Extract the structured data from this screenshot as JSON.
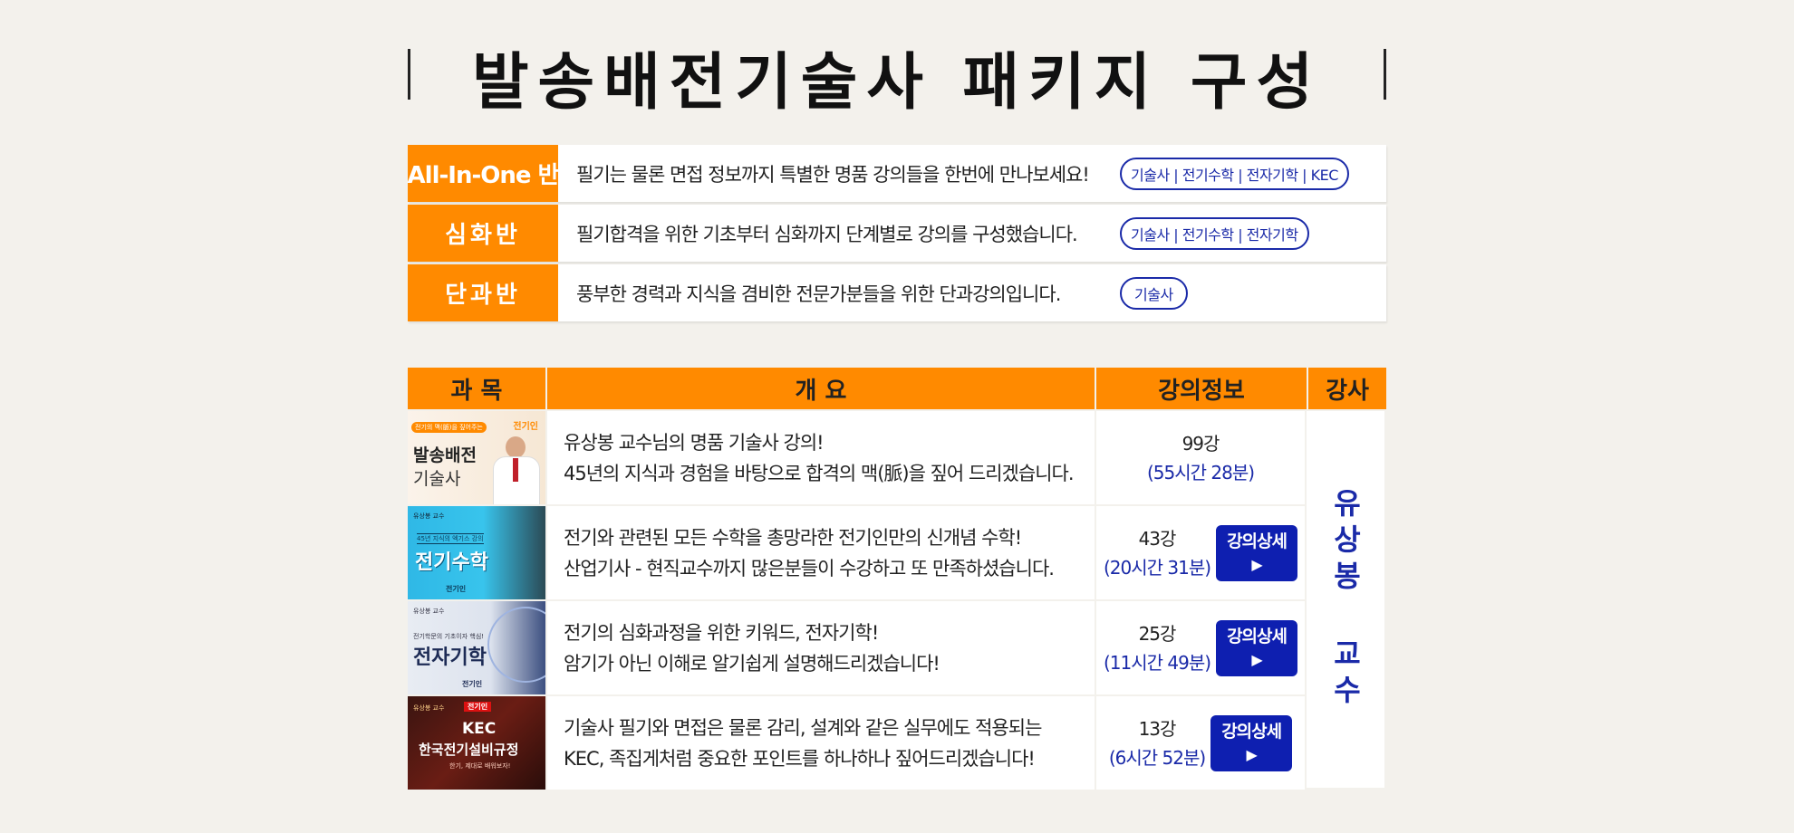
{
  "title": "발송배전기술사 패키지 구성",
  "packages": [
    {
      "label": "All-In-One 반",
      "desc": "필기는 물론 면접 정보까지 특별한 명품 강의들을 한번에 만나보세요!",
      "tags": "기술사 | 전기수학 | 전자기학 | KEC"
    },
    {
      "label": "심화반",
      "desc": "필기합격을 위한 기초부터 심화까지 단계별로 강의를 구성했습니다.",
      "tags": "기술사 | 전기수학 | 전자기학"
    },
    {
      "label": "단과반",
      "desc": "풍부한 경력과 지식을 겸비한 전문가분들을 위한 단과강의입니다.",
      "tags": "기술사"
    }
  ],
  "table": {
    "headers": {
      "subject": "과 목",
      "overview": "개 요",
      "info": "강의정보",
      "teacher": "강사"
    },
    "teacher": "유상봉 교수",
    "detail_label": "강의상세",
    "detail_arrow": "▶",
    "rows": [
      {
        "thumb_brand": "전기인",
        "thumb_sub": "전기의 맥(脈)을 짚어주는",
        "thumb_title1": "발송배전",
        "thumb_title2": "기술사",
        "line1": "유상봉 교수님의 명품 기술사 강의!",
        "line2": "45년의 지식과 경험을 바탕으로 합격의 맥(脈)을 짚어 드리겠습니다.",
        "count": "99강",
        "duration": "(55시간 28분)",
        "has_detail": false
      },
      {
        "thumb_brand": "유상봉 교수",
        "thumb_sub": "45년 지식의 엑기스 강의",
        "thumb_title1": "전기수학",
        "thumb_title2": "전기인",
        "line1": "전기와 관련된 모든 수학을 총망라한 전기인만의 신개념 수학!",
        "line2": "산업기사 - 현직교수까지 많은분들이 수강하고 또 만족하셨습니다.",
        "count": "43강",
        "duration": "(20시간 31분)",
        "has_detail": true
      },
      {
        "thumb_brand": "유상봉 교수",
        "thumb_sub": "전기학문의 기초이자 핵심!",
        "thumb_title1": "전자기학",
        "thumb_title2": "전기인",
        "line1": "전기의 심화과정을 위한 키워드, 전자기학!",
        "line2": "암기가 아닌 이해로 알기쉽게 설명해드리겠습니다!",
        "count": "25강",
        "duration": "(11시간 49분)",
        "has_detail": true
      },
      {
        "thumb_brand": "전기인",
        "thumb_sub": "유상봉 교수",
        "thumb_title1": "KEC",
        "thumb_title2": "한국전기설비규정",
        "thumb_foot": "한기, 제대로 배워보자!",
        "line1": "기술사 필기와 면접은 물론 감리, 설계와 같은 실무에도 적용되는",
        "line2": "KEC, 족집게처럼 중요한 포인트를 하나하나 짚어드리겠습니다!",
        "count": "13강",
        "duration": "(6시간 52분)",
        "has_detail": true
      }
    ]
  }
}
